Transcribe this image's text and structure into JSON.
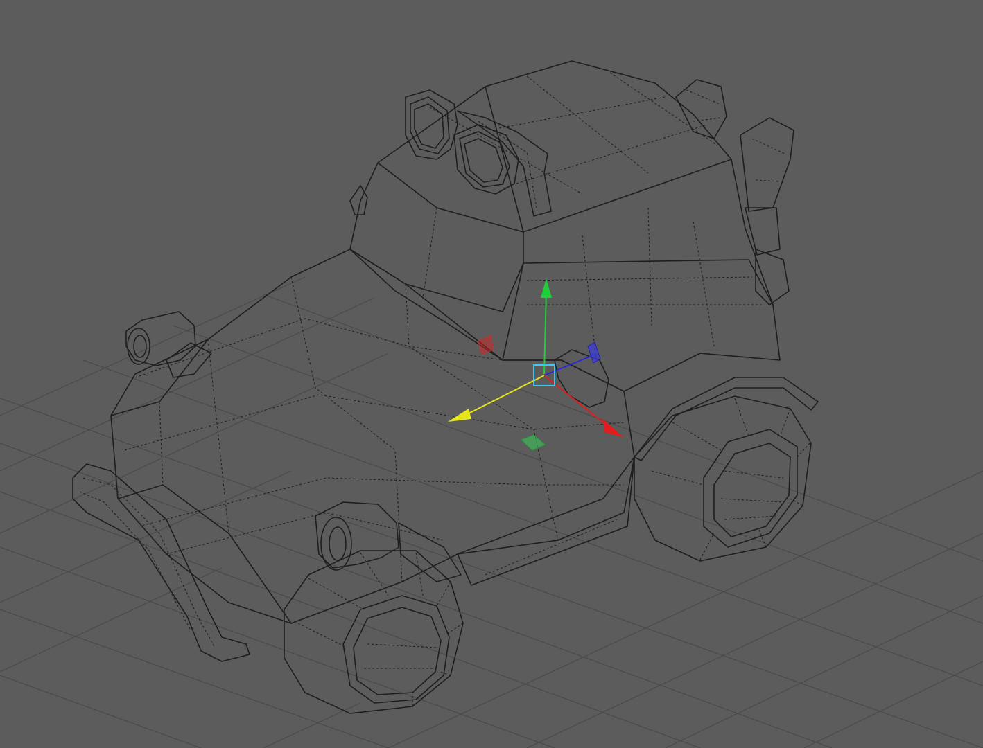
{
  "viewport": {
    "background_color": "#5c5c5c",
    "grid_color": "#4a4a4a",
    "mesh_color": "#9a9a9a",
    "wire_color": "#1e1e1e",
    "view_mode": "perspective"
  },
  "manipulator": {
    "tool": "move-tool",
    "axis_colors": {
      "x": "#e01e1e",
      "y": "#1ecf3a",
      "z": "#2b2bd6",
      "view": "#e6e61a",
      "center": "#3fc9f0"
    }
  },
  "scene": {
    "object": "vehicle-mesh",
    "parts": [
      "cab",
      "hood",
      "front-wheel",
      "rear-wheel",
      "roof-lights",
      "headlights",
      "bumper-bar",
      "exhaust-pipes",
      "side-mirror",
      "running-board"
    ]
  }
}
